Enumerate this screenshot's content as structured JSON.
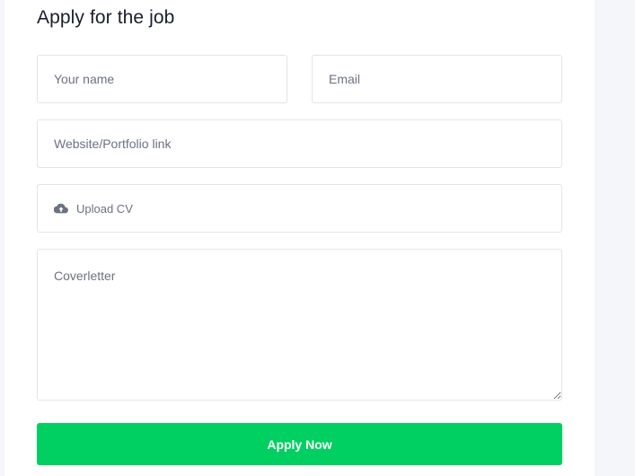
{
  "form": {
    "title": "Apply for the job",
    "name_placeholder": "Your name",
    "email_placeholder": "Email",
    "website_placeholder": "Website/Portfolio link",
    "upload_label": "Upload CV",
    "upload_icon": "cloud-upload-icon",
    "coverletter_placeholder": "Coverletter",
    "submit_label": "Apply Now"
  },
  "colors": {
    "accent": "#00d061",
    "page_background": "#f4f6fa",
    "card_background": "#ffffff",
    "border": "#e2e4ea",
    "title_text": "#1a1f2b",
    "placeholder_text": "#6b7280"
  }
}
